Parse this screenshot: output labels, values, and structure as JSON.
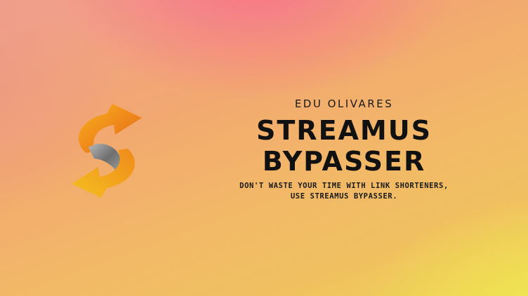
{
  "banner": {
    "author": "EDU OLIVARES",
    "title_line1": "STREAMUS",
    "title_line2": "BYPASSER",
    "tagline_line1": "DON'T WASTE YOUR TIME WITH LINK SHORTENERS,",
    "tagline_line2": "USE STREAMUS BYPASSER.",
    "logo_icon": "streamus-s-arrows-icon",
    "colors": {
      "text": "#111111",
      "logo_orange": "#f08a1a",
      "logo_yellow": "#f5c020",
      "logo_gray": "#8a8a8a"
    }
  }
}
